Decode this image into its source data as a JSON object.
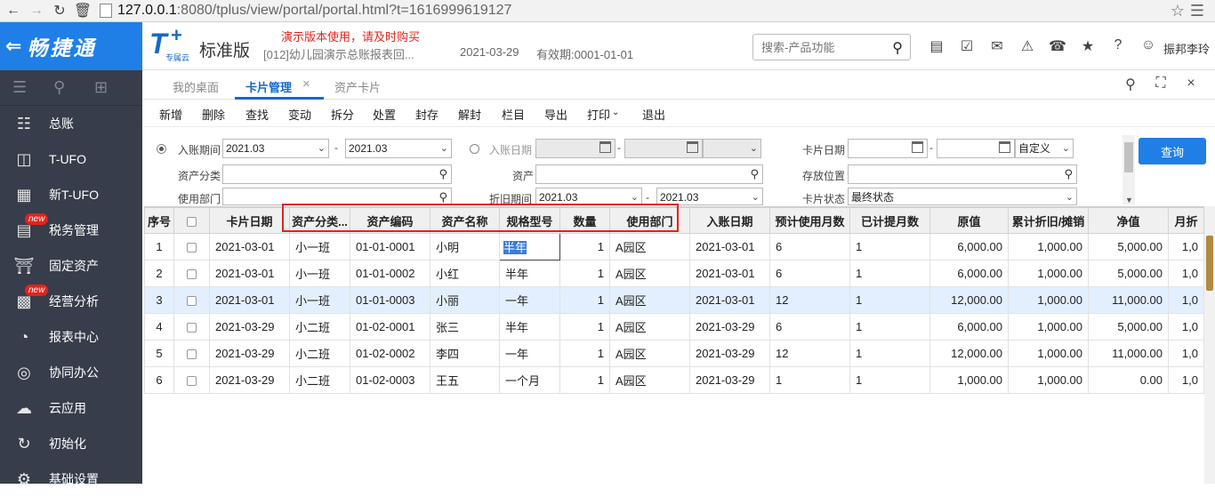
{
  "browser": {
    "url_host": "127.0.0.1",
    "url_path": ":8080/tplus/view/portal/portal.html?t=1616999619127"
  },
  "header": {
    "brand": "畅捷通",
    "logo_sub": "专属云",
    "edition": "标准版",
    "demo_note": "演示版本使用，请及时购买",
    "company": "[012]幼儿园演示总账报表回...",
    "date": "2021-03-29",
    "validity": "有效期:0001-01-01",
    "search_placeholder": "搜索-产品功能",
    "user": "振邦李玲"
  },
  "sidebar": {
    "items": [
      {
        "label": "总账",
        "icon": "ledger-icon",
        "new": false
      },
      {
        "label": "T-UFO",
        "icon": "ufo-icon",
        "new": false
      },
      {
        "label": "新T-UFO",
        "icon": "new-ufo-icon",
        "new": false
      },
      {
        "label": "税务管理",
        "icon": "tax-icon",
        "new": true
      },
      {
        "label": "固定资产",
        "icon": "bank-icon",
        "new": false
      },
      {
        "label": "经营分析",
        "icon": "analysis-icon",
        "new": true
      },
      {
        "label": "报表中心",
        "icon": "pie-chart-icon",
        "new": false
      },
      {
        "label": "协同办公",
        "icon": "collab-icon",
        "new": false
      },
      {
        "label": "云应用",
        "icon": "cloud-icon",
        "new": false
      },
      {
        "label": "初始化",
        "icon": "refresh-icon",
        "new": false
      },
      {
        "label": "基础设置",
        "icon": "gear-icon",
        "new": false
      }
    ],
    "new_badge": "new"
  },
  "tabs": [
    {
      "label": "我的桌面",
      "active": false
    },
    {
      "label": "卡片管理",
      "active": true
    },
    {
      "label": "资产卡片",
      "active": false
    }
  ],
  "toolbar": [
    "新增",
    "删除",
    "查找",
    "变动",
    "拆分",
    "处置",
    "封存",
    "解封",
    "栏目",
    "导出",
    "打印",
    "退出"
  ],
  "filters": {
    "entry_period_label": "入账期间",
    "entry_period_from": "2021.03",
    "entry_period_to": "2021.03",
    "entry_date_label": "入账日期",
    "card_date_label": "卡片日期",
    "card_date_mode": "自定义",
    "asset_class_label": "资产分类",
    "asset_label": "资产",
    "storage_label": "存放位置",
    "dept_label": "使用部门",
    "depr_period_label": "折旧期间",
    "depr_period_from": "2021.03",
    "depr_period_to": "2021.03",
    "card_status_label": "卡片状态",
    "card_status": "最终状态",
    "query_button": "查询"
  },
  "table": {
    "columns": [
      "序号",
      "",
      "卡片日期",
      "资产分类...",
      "资产编码",
      "资产名称",
      "规格型号",
      "数量",
      "使用部门",
      "入账日期",
      "预计使用月数",
      "已计提月数",
      "原值",
      "累计折旧/摊销",
      "净值",
      "月折"
    ],
    "rows": [
      [
        "1",
        "",
        "2021-03-01",
        "小一班",
        "01-01-0001",
        "小明",
        "半年",
        "1",
        "A园区",
        "2021-03-01",
        "6",
        "1",
        "6,000.00",
        "1,000.00",
        "5,000.00",
        "1,0"
      ],
      [
        "2",
        "",
        "2021-03-01",
        "小一班",
        "01-01-0002",
        "小红",
        "半年",
        "1",
        "A园区",
        "2021-03-01",
        "6",
        "1",
        "6,000.00",
        "1,000.00",
        "5,000.00",
        "1,0"
      ],
      [
        "3",
        "",
        "2021-03-01",
        "小一班",
        "01-01-0003",
        "小丽",
        "一年",
        "1",
        "A园区",
        "2021-03-01",
        "12",
        "1",
        "12,000.00",
        "1,000.00",
        "11,000.00",
        "1,0"
      ],
      [
        "4",
        "",
        "2021-03-29",
        "小二班",
        "01-02-0001",
        "张三",
        "半年",
        "1",
        "A园区",
        "2021-03-29",
        "6",
        "1",
        "6,000.00",
        "1,000.00",
        "5,000.00",
        "1,0"
      ],
      [
        "5",
        "",
        "2021-03-29",
        "小二班",
        "01-02-0002",
        "李四",
        "一年",
        "1",
        "A园区",
        "2021-03-29",
        "12",
        "1",
        "12,000.00",
        "1,000.00",
        "11,000.00",
        "1,0"
      ],
      [
        "6",
        "",
        "2021-03-29",
        "小二班",
        "01-02-0003",
        "王五",
        "一个月",
        "1",
        "A园区",
        "2021-03-29",
        "1",
        "1",
        "1,000.00",
        "1,000.00",
        "0.00",
        "1,0"
      ]
    ],
    "selected_row": 2
  },
  "colors": {
    "brand_blue": "#1f7fe6",
    "sidebar_bg": "#373d4a",
    "highlight_red": "#e2231a",
    "selected_row": "#e3efff"
  }
}
